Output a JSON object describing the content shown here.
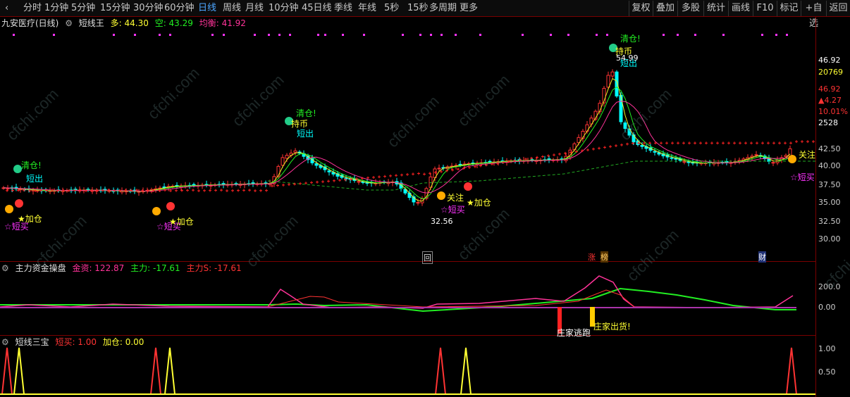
{
  "toolbar": {
    "periods": [
      "分时",
      "1分钟",
      "5分钟",
      "15分钟",
      "30分钟",
      "60分钟",
      "日线",
      "周线",
      "月线",
      "10分钟",
      "45日线",
      "季线",
      "年线",
      "5秒",
      "15秒",
      "多周期",
      "更多"
    ],
    "active": "日线",
    "right": [
      "复权",
      "叠加",
      "多股",
      "统计",
      "画线",
      "F10",
      "标记",
      "+自选",
      "返回"
    ]
  },
  "main": {
    "stock": "九安医疗(日线)",
    "indicator": "短线王",
    "duo": "多: 44.30",
    "kong": "空: 43.29",
    "junheng": "均衡: 41.92",
    "price_labels": [
      "46.92",
      "20769",
      "46.92",
      "▲4.27",
      "10.01%",
      "2528"
    ],
    "y_ticks": [
      "42.50",
      "40.00",
      "37.50",
      "35.00",
      "32.50",
      "30.00"
    ],
    "high_label": "54.99",
    "low_label": "32.56",
    "event_markers": [
      "回",
      "涨",
      "榜",
      "财"
    ]
  },
  "signals": {
    "qingcang": "清仓!",
    "duanchu": "短出",
    "chibi": "持币",
    "duanmai": "☆短买",
    "jiacang": "★加仓",
    "guanzhu": "关注"
  },
  "fund": {
    "title": "主力资金操盘",
    "jinzi": "金资: 122.87",
    "zhuli": "主力: -17.61",
    "zhulis": "主力S: -17.61",
    "y_ticks": [
      "200.0",
      "0.00"
    ],
    "escape_label": "庄家逃跑",
    "sell_label": "庄家出货!"
  },
  "three": {
    "title": "短线三宝",
    "duanmai": "短买: 1.00",
    "jiacang": "加仓: 0.00",
    "y_ticks": [
      "1.00",
      "0.50"
    ]
  },
  "watermark": "cfchi.com",
  "colors": {
    "up": "#ff3333",
    "down": "#00ffff",
    "ma_pink": "#ff3399",
    "ma_green": "#22ee22",
    "ma_yellow": "#eeee22",
    "support": "#ff2222"
  }
}
